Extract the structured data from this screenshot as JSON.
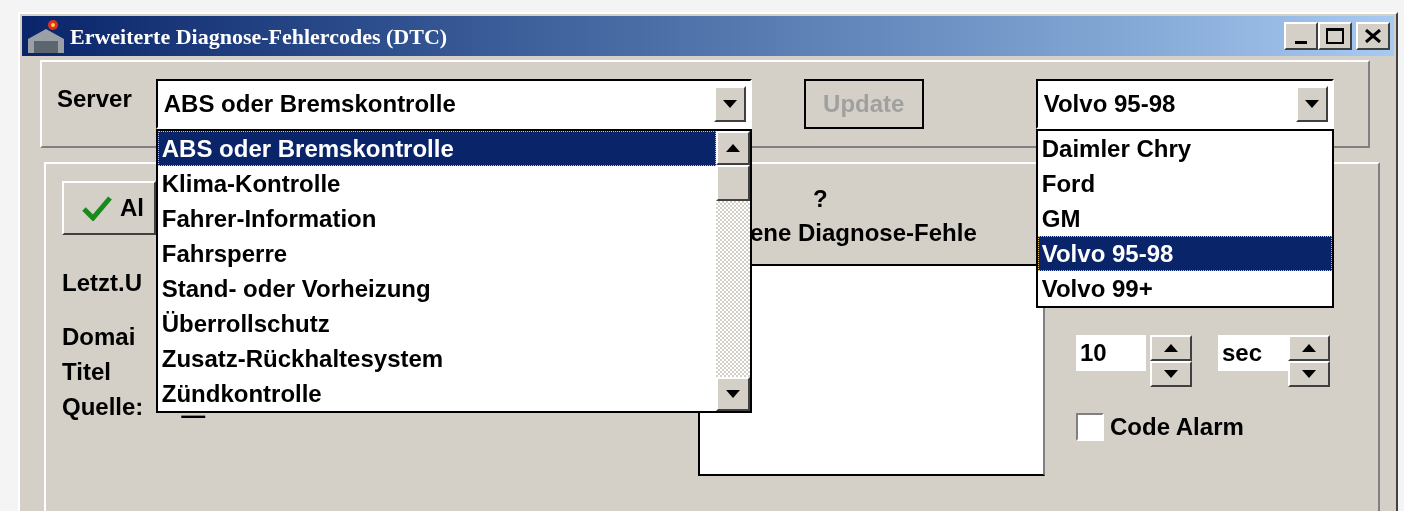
{
  "window": {
    "title": "Erweiterte Diagnose-Fehlercodes (DTC)"
  },
  "server": {
    "label": "Server",
    "value": "ABS oder Bremskontrolle",
    "expanded": true,
    "options": [
      {
        "label": "ABS oder Bremskontrolle",
        "selected": true
      },
      {
        "label": "Klima-Kontrolle",
        "selected": false
      },
      {
        "label": "Fahrer-Information",
        "selected": false
      },
      {
        "label": "Fahrsperre",
        "selected": false
      },
      {
        "label": "Stand- oder Vorheizung",
        "selected": false
      },
      {
        "label": "Überrollschutz",
        "selected": false
      },
      {
        "label": "Zusatz-Rückhaltesystem",
        "selected": false
      },
      {
        "label": "Zündkontrolle",
        "selected": false
      }
    ]
  },
  "update_button": {
    "label": "Update",
    "disabled": true
  },
  "make": {
    "value": "Volvo 95-98",
    "expanded": true,
    "options": [
      {
        "label": "Daimler Chry",
        "selected": false
      },
      {
        "label": "Ford",
        "selected": false
      },
      {
        "label": "GM",
        "selected": false
      },
      {
        "label": "Volvo 95-98",
        "selected": true
      },
      {
        "label": "Volvo 99+",
        "selected": false
      }
    ]
  },
  "apply_button": {
    "label": "Al"
  },
  "info_labels": [
    "Letzt.U",
    "Domai",
    "Titel"
  ],
  "source": {
    "label": "Quelle:",
    "value": "—"
  },
  "list": {
    "marker": "?",
    "heading": "ene Diagnose-Fehle"
  },
  "interval": {
    "value": "10"
  },
  "unit": {
    "value": "sec"
  },
  "code_alarm": {
    "label": "Code Alarm",
    "checked": false
  }
}
